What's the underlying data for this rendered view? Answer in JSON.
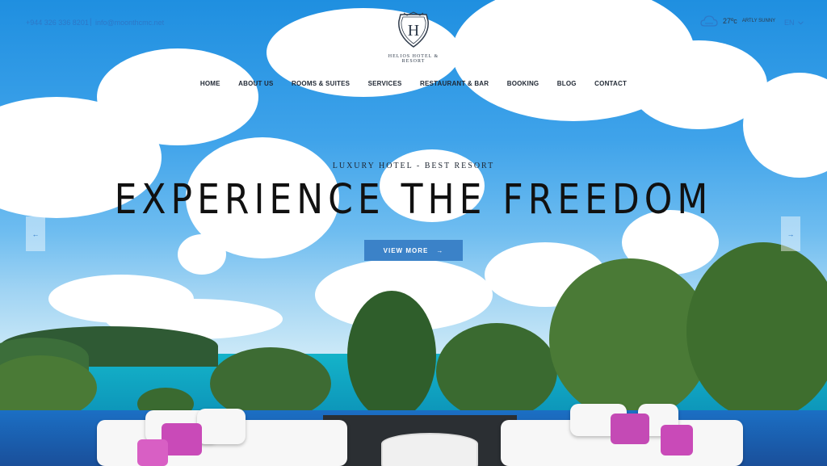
{
  "topbar": {
    "phone": "+944 326 336 8201",
    "separator": "|",
    "email": "info@moonthcmc.net"
  },
  "logo": {
    "letter": "H",
    "text": "HELIOS HOTEL & RESORT"
  },
  "weather": {
    "icon": "cloud-icon",
    "temperature": "27ºc",
    "description": "ARTLY SUNNY"
  },
  "language": {
    "selected": "EN"
  },
  "nav": {
    "items": [
      "HOME",
      "ABOUT US",
      "ROOMS & SUITES",
      "SERVICES",
      "RESTAURANT & BAR",
      "BOOKING",
      "BLOG",
      "CONTACT"
    ]
  },
  "hero": {
    "tagline": "LUXURY HOTEL - BEST RESORT",
    "headline": "EXPERIENCE THE FREEDOM",
    "button_label": "VIEW MORE",
    "button_arrow": "→",
    "prev_arrow": "←",
    "next_arrow": "→"
  },
  "colors": {
    "accent": "#3b82c8",
    "link": "#2d78c8",
    "text": "#1f2733"
  }
}
